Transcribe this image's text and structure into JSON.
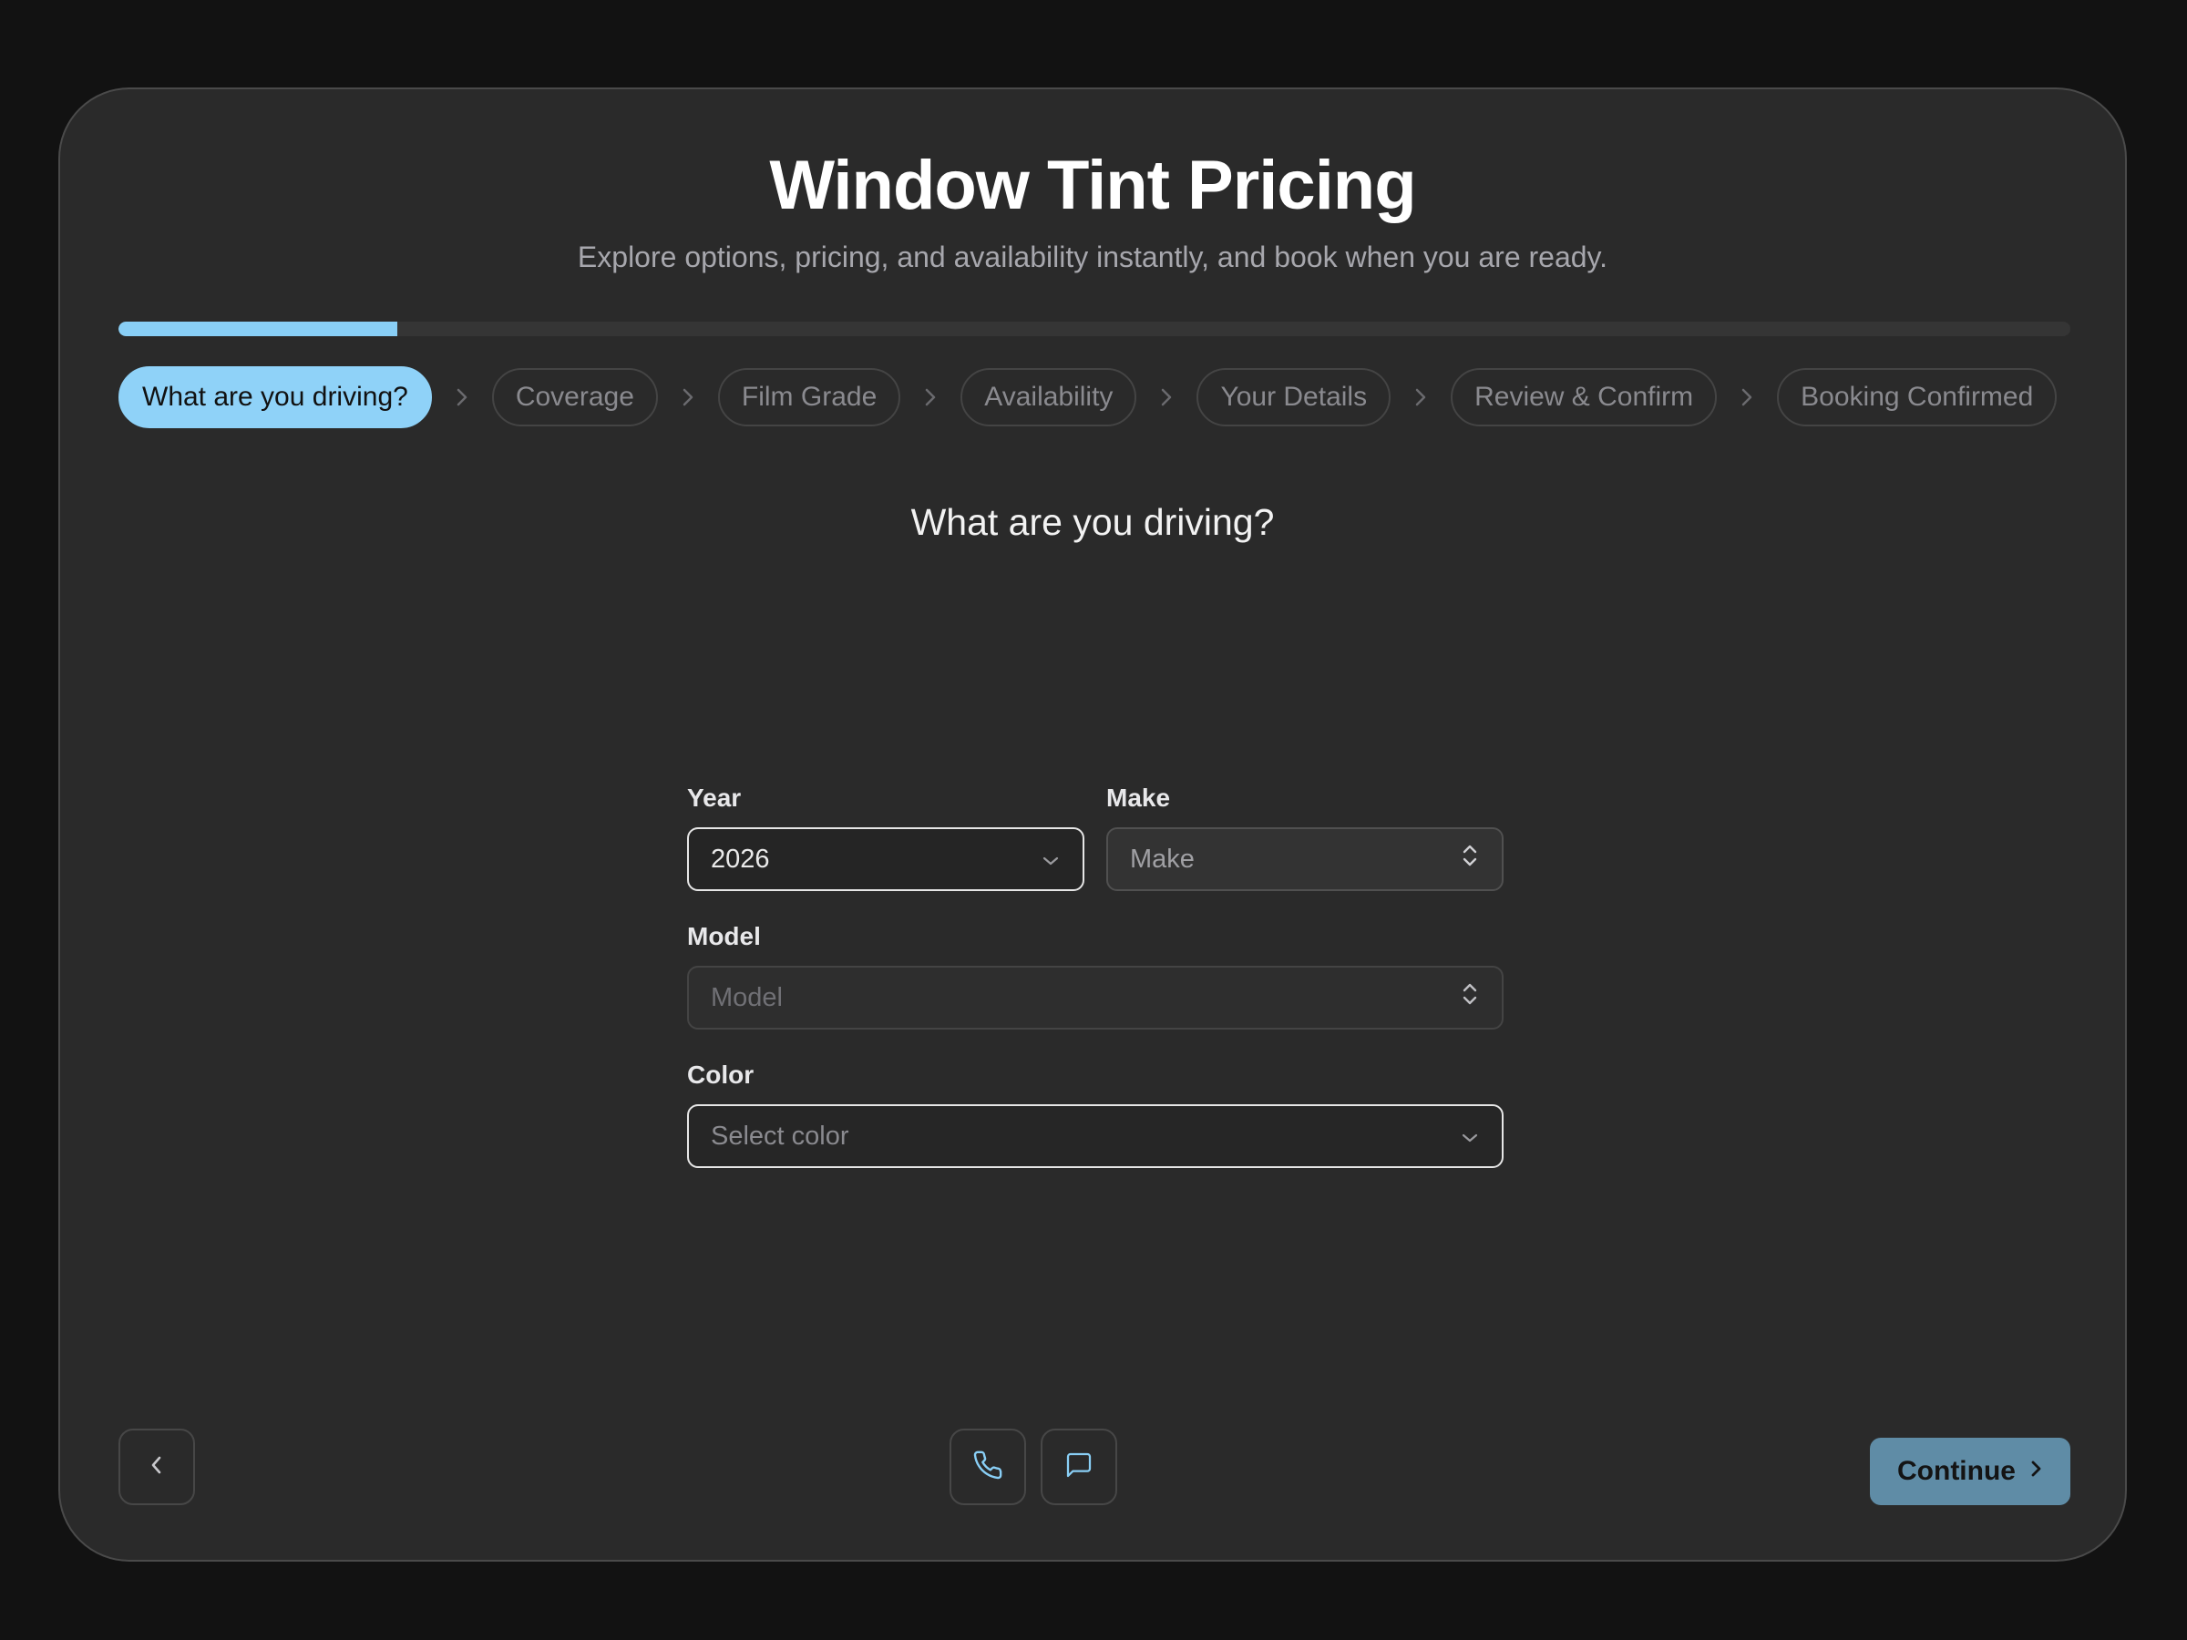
{
  "header": {
    "title": "Window Tint Pricing",
    "subtitle": "Explore options, pricing, and availability instantly, and book when you are ready."
  },
  "progress": {
    "current_step": 1,
    "total_steps": 7,
    "fill_fraction": 0.143,
    "fill_color": "#89cff6"
  },
  "steps": [
    {
      "label": "What are you driving?",
      "active": true
    },
    {
      "label": "Coverage",
      "active": false
    },
    {
      "label": "Film Grade",
      "active": false
    },
    {
      "label": "Availability",
      "active": false
    },
    {
      "label": "Your Details",
      "active": false
    },
    {
      "label": "Review & Confirm",
      "active": false
    },
    {
      "label": "Booking Confirmed",
      "active": false
    }
  ],
  "question": "What are you driving?",
  "form": {
    "year": {
      "label": "Year",
      "value": "2026",
      "icon": "chevron-down-icon"
    },
    "make": {
      "label": "Make",
      "placeholder": "Make",
      "icon": "chevron-up-down-icon"
    },
    "model": {
      "label": "Model",
      "placeholder": "Model",
      "icon": "chevron-up-down-icon"
    },
    "color": {
      "label": "Color",
      "placeholder": "Select color",
      "icon": "chevron-down-icon"
    }
  },
  "footer": {
    "back_icon": "chevron-left-icon",
    "phone_icon": "phone-icon",
    "chat_icon": "chat-icon",
    "continue_label": "Continue",
    "continue_color": "#5f8ca6"
  },
  "colors": {
    "accent": "#89cff6",
    "background": "#121212",
    "card": "#2a2a2a"
  }
}
